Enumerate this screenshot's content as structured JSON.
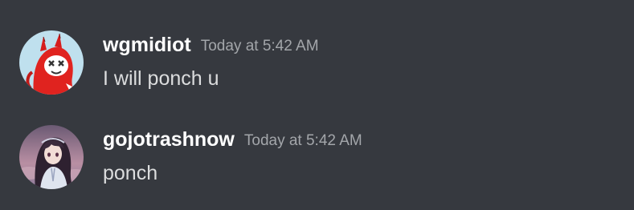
{
  "colors": {
    "background": "#36393f",
    "username": "#ffffff",
    "timestamp": "#a3a6aa",
    "message_text": "#dcddde"
  },
  "messages": [
    {
      "author": "wgmidiot",
      "timestamp": "Today at 5:42 AM",
      "content": "I will ponch u",
      "avatar_icon": "red-devil-avatar-icon"
    },
    {
      "author": "gojotrashnow",
      "timestamp": "Today at 5:42 AM",
      "content": "ponch",
      "avatar_icon": "anime-girl-avatar-icon"
    }
  ]
}
